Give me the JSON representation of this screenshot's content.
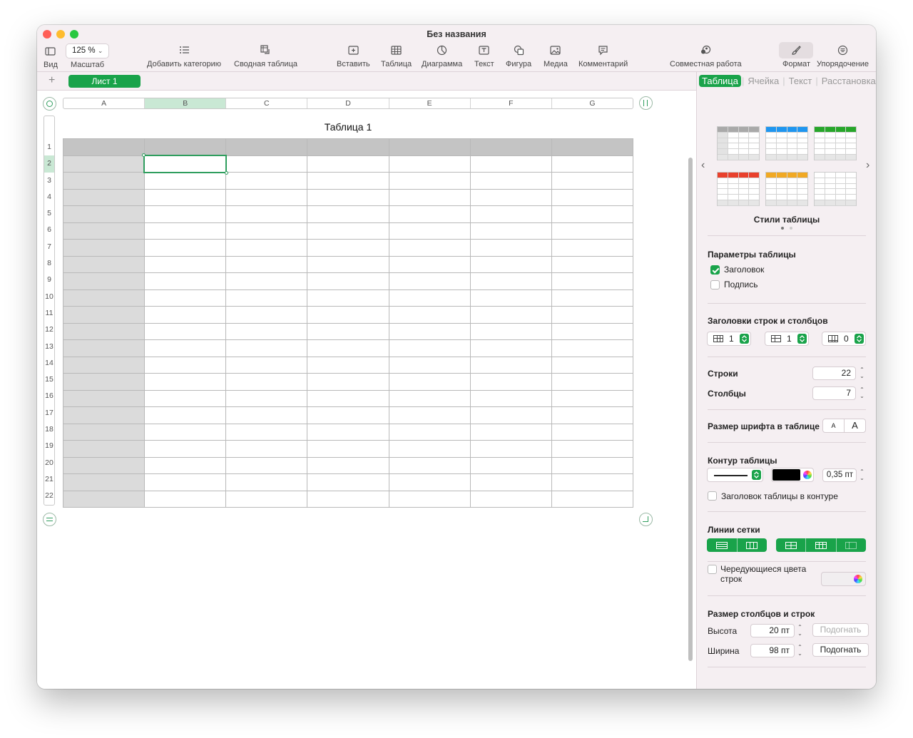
{
  "window": {
    "title": "Без названия"
  },
  "toolbar": {
    "view": "Вид",
    "zoom_value": "125 %",
    "zoom": "Масштаб",
    "add_category": "Добавить категорию",
    "pivot": "Сводная таблица",
    "insert": "Вставить",
    "table": "Таблица",
    "chart": "Диаграмма",
    "text": "Текст",
    "shape": "Фигура",
    "media": "Медиа",
    "comment": "Комментарий",
    "collaborate": "Совместная работа",
    "format": "Формат",
    "organize": "Упорядочение"
  },
  "sheet": {
    "add": "+",
    "tab": "Лист 1"
  },
  "table": {
    "title": "Таблица 1",
    "columns": [
      "A",
      "B",
      "C",
      "D",
      "E",
      "F",
      "G"
    ],
    "rows": [
      "1",
      "2",
      "3",
      "4",
      "5",
      "6",
      "7",
      "8",
      "9",
      "10",
      "11",
      "12",
      "13",
      "14",
      "15",
      "16",
      "17",
      "18",
      "19",
      "20",
      "21",
      "22"
    ],
    "selected": "B2"
  },
  "sidebar": {
    "tabs": [
      "Таблица",
      "Ячейка",
      "Текст",
      "Расстановка"
    ],
    "styles_title": "Стили таблицы",
    "params_title": "Параметры таблицы",
    "header": "Заголовок",
    "caption": "Подпись",
    "headers_title": "Заголовки строк и столбцов",
    "header_rows": "1",
    "header_cols": "1",
    "footer_rows": "0",
    "rows_label": "Строки",
    "rows_value": "22",
    "cols_label": "Столбцы",
    "cols_value": "7",
    "font_size_label": "Размер шрифта в таблице",
    "font_small": "A",
    "font_large": "A",
    "outline_title": "Контур таблицы",
    "outline_width": "0,35 пт",
    "outline_header": "Заголовок таблицы в контуре",
    "gridlines_title": "Линии сетки",
    "alternate": "Чередующиеся цвета строк",
    "size_title": "Размер столбцов и строк",
    "height_label": "Высота",
    "height_value": "20 пт",
    "width_label": "Ширина",
    "width_value": "98 пт",
    "fit": "Подогнать"
  },
  "colors": {
    "accent": "#19a34a",
    "close": "#ff5f57",
    "minimize": "#febc2e",
    "maximize": "#28c840"
  }
}
